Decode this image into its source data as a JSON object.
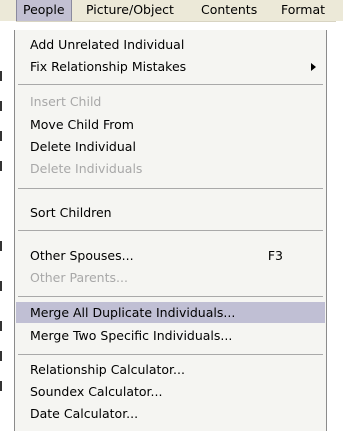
{
  "menubar": {
    "items": [
      "People",
      "Picture/Object",
      "Contents",
      "Format"
    ]
  },
  "dropdown": {
    "items": [
      {
        "label": "Add Unrelated Individual",
        "enabled": true
      },
      {
        "label": "Fix Relationship Mistakes",
        "enabled": true,
        "submenu": true
      },
      {
        "label": "Insert Child",
        "enabled": false
      },
      {
        "label": "Move Child From",
        "enabled": true
      },
      {
        "label": "Delete Individual",
        "enabled": true
      },
      {
        "label": "Delete Individuals",
        "enabled": false
      },
      {
        "label": "Sort Children",
        "enabled": true
      },
      {
        "label": "Other Spouses...",
        "enabled": true,
        "shortcut": "F3"
      },
      {
        "label": "Other Parents...",
        "enabled": false
      },
      {
        "label": "Merge All Duplicate Individuals...",
        "enabled": true,
        "highlighted": true
      },
      {
        "label": "Merge Two Specific Individuals...",
        "enabled": true
      },
      {
        "label": "Relationship Calculator...",
        "enabled": true
      },
      {
        "label": "Soundex Calculator...",
        "enabled": true
      },
      {
        "label": "Date Calculator...",
        "enabled": true
      }
    ]
  },
  "colors": {
    "menubar_bg": "#ece9d8",
    "highlight": "#c0bfd4",
    "disabled_text": "#a8a8a8"
  }
}
